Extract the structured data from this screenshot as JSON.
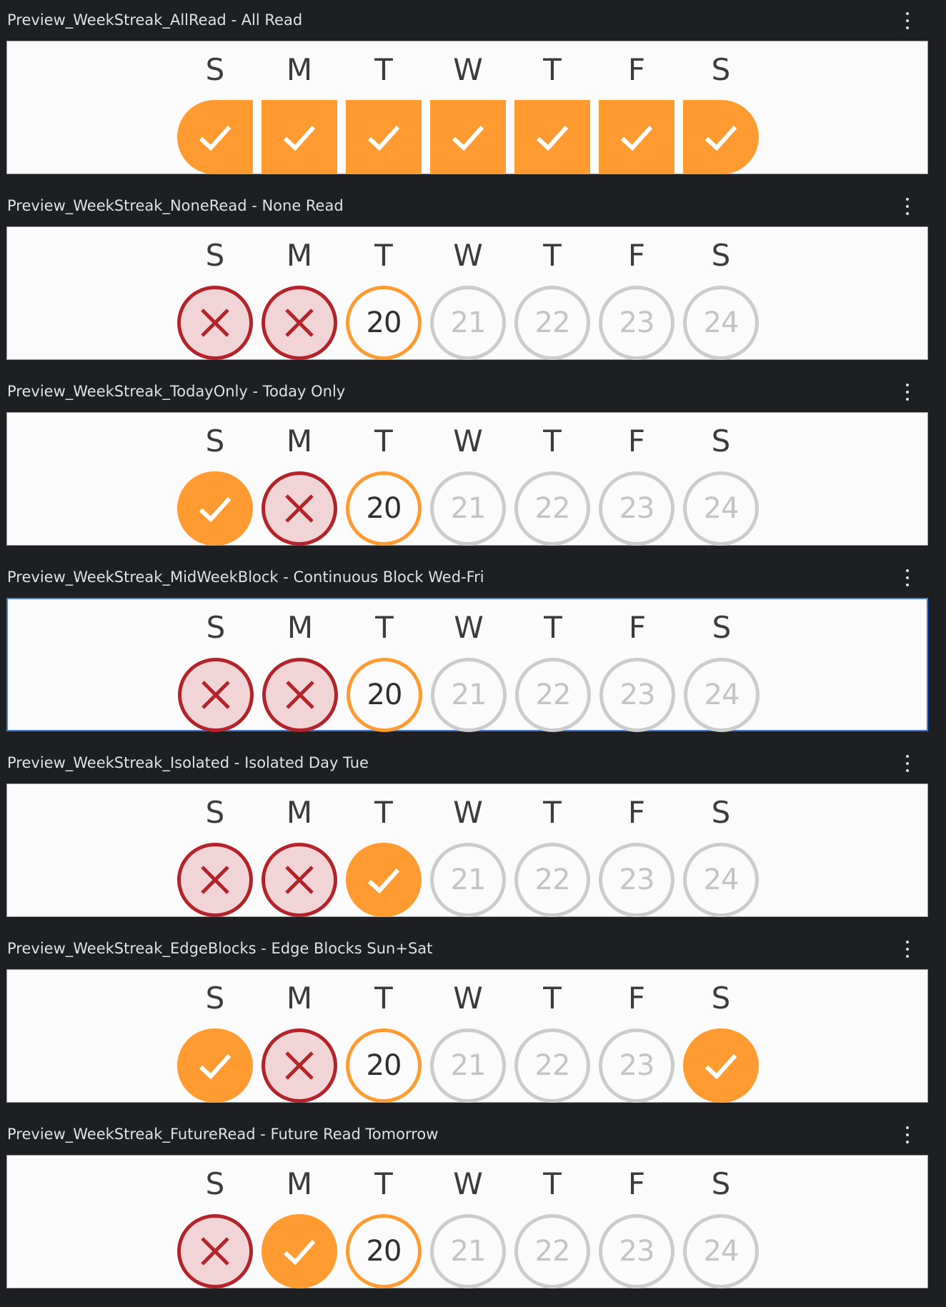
{
  "day_letters": [
    "S",
    "M",
    "T",
    "W",
    "T",
    "F",
    "S"
  ],
  "colors": {
    "background": "#1e1f22",
    "frame": "#fbfbfb",
    "read": "#ff9b30",
    "missed_border": "#b3232a",
    "missed_fill": "#f1d4d6",
    "today_border": "#ff9b30",
    "future_border": "#cccccc",
    "selection": "#3d7ae4"
  },
  "previews": [
    {
      "title": "Preview_WeekStreak_AllRead - All Read",
      "selected": false,
      "days": [
        {
          "state": "read",
          "icon": "checkmark-icon"
        },
        {
          "state": "read",
          "icon": "checkmark-icon"
        },
        {
          "state": "read",
          "icon": "checkmark-icon"
        },
        {
          "state": "read",
          "icon": "checkmark-icon"
        },
        {
          "state": "read",
          "icon": "checkmark-icon"
        },
        {
          "state": "read",
          "icon": "checkmark-icon"
        },
        {
          "state": "read",
          "icon": "checkmark-icon"
        }
      ]
    },
    {
      "title": "Preview_WeekStreak_NoneRead - None Read",
      "selected": false,
      "days": [
        {
          "state": "missed",
          "icon": "cross-icon"
        },
        {
          "state": "missed",
          "icon": "cross-icon"
        },
        {
          "state": "today",
          "label": "20"
        },
        {
          "state": "future",
          "label": "21"
        },
        {
          "state": "future",
          "label": "22"
        },
        {
          "state": "future",
          "label": "23"
        },
        {
          "state": "future",
          "label": "24"
        }
      ]
    },
    {
      "title": "Preview_WeekStreak_TodayOnly - Today Only",
      "selected": false,
      "days": [
        {
          "state": "read",
          "icon": "checkmark-icon"
        },
        {
          "state": "missed",
          "icon": "cross-icon"
        },
        {
          "state": "today",
          "label": "20"
        },
        {
          "state": "future",
          "label": "21"
        },
        {
          "state": "future",
          "label": "22"
        },
        {
          "state": "future",
          "label": "23"
        },
        {
          "state": "future",
          "label": "24"
        }
      ]
    },
    {
      "title": "Preview_WeekStreak_MidWeekBlock - Continuous Block Wed-Fri",
      "selected": true,
      "days": [
        {
          "state": "missed",
          "icon": "cross-icon"
        },
        {
          "state": "missed",
          "icon": "cross-icon"
        },
        {
          "state": "today",
          "label": "20"
        },
        {
          "state": "future",
          "label": "21"
        },
        {
          "state": "future",
          "label": "22"
        },
        {
          "state": "future",
          "label": "23"
        },
        {
          "state": "future",
          "label": "24"
        }
      ]
    },
    {
      "title": "Preview_WeekStreak_Isolated - Isolated Day Tue",
      "selected": false,
      "days": [
        {
          "state": "missed",
          "icon": "cross-icon"
        },
        {
          "state": "missed",
          "icon": "cross-icon"
        },
        {
          "state": "read",
          "icon": "checkmark-icon"
        },
        {
          "state": "future",
          "label": "21"
        },
        {
          "state": "future",
          "label": "22"
        },
        {
          "state": "future",
          "label": "23"
        },
        {
          "state": "future",
          "label": "24"
        }
      ]
    },
    {
      "title": "Preview_WeekStreak_EdgeBlocks - Edge Blocks Sun+Sat",
      "selected": false,
      "days": [
        {
          "state": "read",
          "icon": "checkmark-icon"
        },
        {
          "state": "missed",
          "icon": "cross-icon"
        },
        {
          "state": "today",
          "label": "20"
        },
        {
          "state": "future",
          "label": "21"
        },
        {
          "state": "future",
          "label": "22"
        },
        {
          "state": "future",
          "label": "23"
        },
        {
          "state": "read",
          "icon": "checkmark-icon"
        }
      ]
    },
    {
      "title": "Preview_WeekStreak_FutureRead - Future Read Tomorrow",
      "selected": false,
      "days": [
        {
          "state": "missed",
          "icon": "cross-icon"
        },
        {
          "state": "read",
          "icon": "checkmark-icon"
        },
        {
          "state": "today",
          "label": "20"
        },
        {
          "state": "future",
          "label": "21"
        },
        {
          "state": "future",
          "label": "22"
        },
        {
          "state": "future",
          "label": "23"
        },
        {
          "state": "future",
          "label": "24"
        }
      ]
    }
  ]
}
